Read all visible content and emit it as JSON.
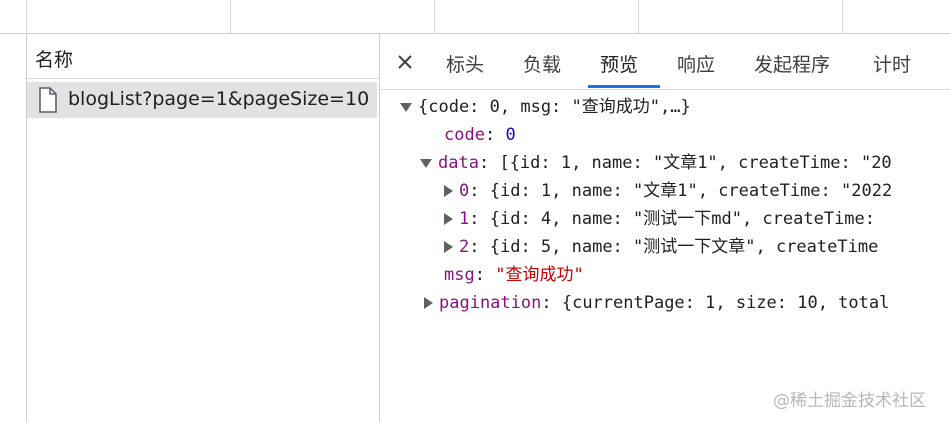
{
  "name_panel": {
    "header": "名称",
    "request": {
      "icon": "file-icon",
      "label": "blogList?page=1&pageSize=10"
    }
  },
  "detail_panel": {
    "close_icon": "close-icon",
    "tabs": [
      {
        "label": "标头",
        "active": false
      },
      {
        "label": "负载",
        "active": false
      },
      {
        "label": "预览",
        "active": true
      },
      {
        "label": "响应",
        "active": false
      },
      {
        "label": "发起程序",
        "active": false
      },
      {
        "label": "计时",
        "active": false
      }
    ]
  },
  "preview": {
    "root": "{code: 0, msg: \"查询成功\",…}",
    "code_key": "code",
    "code_value": "0",
    "data_key": "data",
    "data_summary": "[{id: 1, name: \"文章1\", createTime: \"20",
    "items": [
      {
        "key": "0",
        "value": "{id: 1, name: \"文章1\", createTime: \"2022"
      },
      {
        "key": "1",
        "value": "{id: 4, name: \"测试一下md\", createTime: "
      },
      {
        "key": "2",
        "value": "{id: 5, name: \"测试一下文章\", createTime"
      }
    ],
    "msg_key": "msg",
    "msg_value": "\"查询成功\"",
    "pagination_key": "pagination",
    "pagination_summary": "{currentPage: 1, size: 10, total"
  },
  "watermark": "@稀土掘金技术社区",
  "colors": {
    "active_tab_underline": "#1a73e8",
    "selected_row": "#e2e2e2",
    "key": "#881280",
    "number": "#1c00cf",
    "string": "#c80000"
  }
}
